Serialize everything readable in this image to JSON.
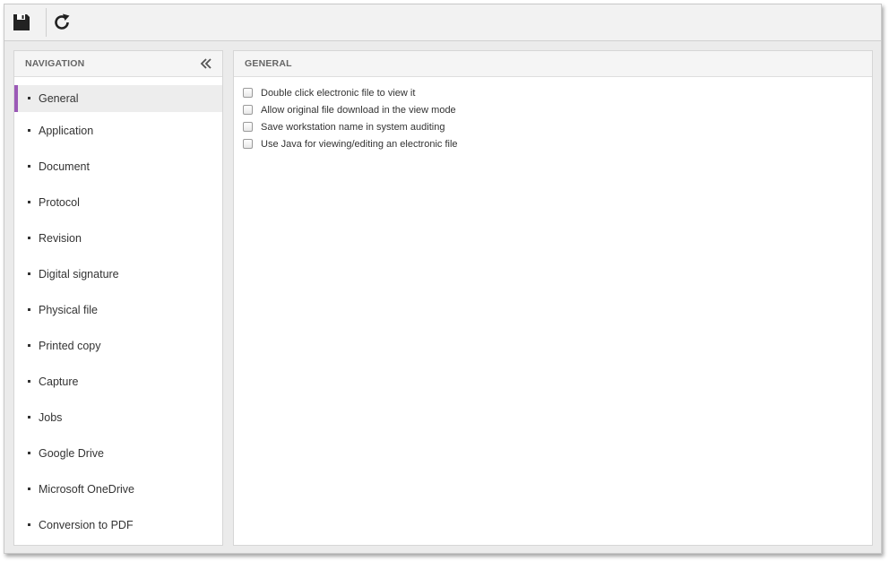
{
  "toolbar": {
    "save_icon": "floppy-disk-icon",
    "refresh_icon": "refresh-icon"
  },
  "navigation": {
    "title": "NAVIGATION",
    "collapse_icon": "double-chevron-left-icon",
    "active_color": "#9b59b6",
    "items": [
      {
        "label": "General"
      },
      {
        "label": "Application"
      },
      {
        "label": "Document"
      },
      {
        "label": "Protocol"
      },
      {
        "label": "Revision"
      },
      {
        "label": "Digital signature"
      },
      {
        "label": "Physical file"
      },
      {
        "label": "Printed copy"
      },
      {
        "label": "Capture"
      },
      {
        "label": "Jobs"
      },
      {
        "label": "Google Drive"
      },
      {
        "label": "Microsoft OneDrive"
      },
      {
        "label": "Conversion to PDF"
      }
    ]
  },
  "general": {
    "title": "GENERAL",
    "options": [
      {
        "label": "Double click electronic file to view it",
        "checked": false
      },
      {
        "label": "Allow original file download in the view mode",
        "checked": false
      },
      {
        "label": "Save workstation name in system auditing",
        "checked": false
      },
      {
        "label": "Use Java for viewing/editing an electronic file",
        "checked": false
      }
    ]
  }
}
